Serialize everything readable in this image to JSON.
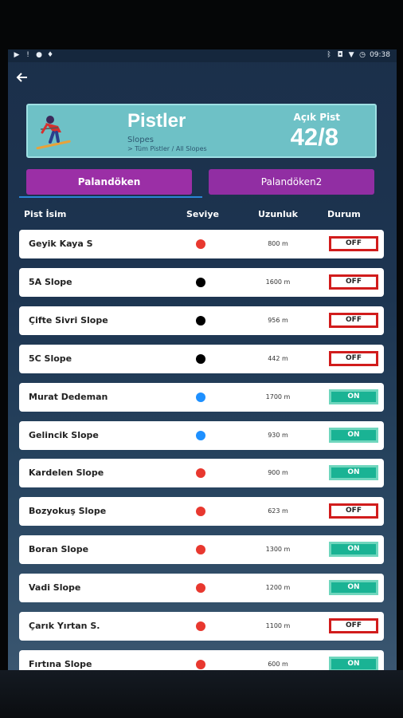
{
  "status_bar": {
    "time": "09:38",
    "left_icons": [
      "youtube-icon",
      "alert-icon",
      "chat-icon",
      "location-icon"
    ],
    "right_icons": [
      "bluetooth-icon",
      "vibrate-icon",
      "wifi-icon",
      "alarm-icon"
    ]
  },
  "header": {
    "title": "Pistler",
    "subtitle": "Slopes",
    "breadcrumb": "> Tüm Pistler / All Slopes",
    "open_label": "Açık Pist",
    "open_value": "42/8",
    "card_color": "#6ec1c6"
  },
  "tabs": [
    {
      "label": "Palandöken",
      "active": true
    },
    {
      "label": "Palandöken2",
      "active": false
    }
  ],
  "columns": {
    "name": "Pist İsim",
    "level": "Seviye",
    "length": "Uzunluk",
    "status": "Durum"
  },
  "level_colors": {
    "red": "#e8382f",
    "black": "#000000",
    "blue": "#1e90ff"
  },
  "status_colors": {
    "OFF": "#d11c1c",
    "ON": "#1ab394"
  },
  "slopes": [
    {
      "name": "Geyik Kaya S",
      "level": "red",
      "length": "800 m",
      "status": "OFF"
    },
    {
      "name": "5A Slope",
      "level": "black",
      "length": "1600 m",
      "status": "OFF"
    },
    {
      "name": "Çifte Sivri Slope",
      "level": "black",
      "length": "956 m",
      "status": "OFF"
    },
    {
      "name": "5C Slope",
      "level": "black",
      "length": "442 m",
      "status": "OFF"
    },
    {
      "name": "Murat Dedeman",
      "level": "blue",
      "length": "1700 m",
      "status": "ON"
    },
    {
      "name": "Gelincik Slope",
      "level": "blue",
      "length": "930 m",
      "status": "ON"
    },
    {
      "name": "Kardelen Slope",
      "level": "red",
      "length": "900 m",
      "status": "ON"
    },
    {
      "name": "Bozyokuş Slope",
      "level": "red",
      "length": "623 m",
      "status": "OFF"
    },
    {
      "name": "Boran Slope",
      "level": "red",
      "length": "1300 m",
      "status": "ON"
    },
    {
      "name": "Vadi Slope",
      "level": "red",
      "length": "1200 m",
      "status": "ON"
    },
    {
      "name": "Çarık Yırtan S.",
      "level": "red",
      "length": "1100 m",
      "status": "OFF"
    },
    {
      "name": "Fırtına Slope",
      "level": "red",
      "length": "600 m",
      "status": "ON"
    }
  ]
}
